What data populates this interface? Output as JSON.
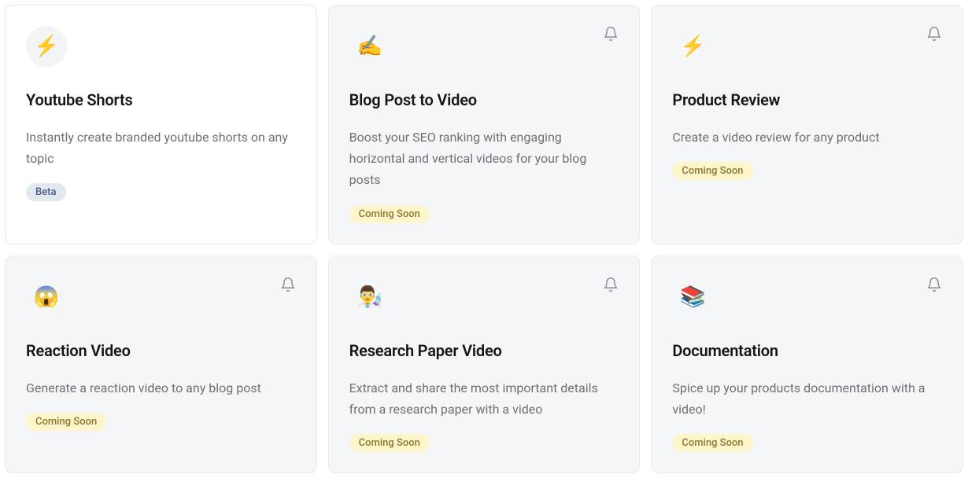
{
  "badges": {
    "beta": "Beta",
    "soon": "Coming Soon"
  },
  "cards": [
    {
      "icon": "⚡",
      "title": "Youtube Shorts",
      "description": "Instantly create branded youtube shorts on any topic",
      "badge": "beta",
      "active": true,
      "bell": false
    },
    {
      "icon": "✍️",
      "title": "Blog Post to Video",
      "description": "Boost your SEO ranking with engaging horizontal and vertical videos for your blog posts",
      "badge": "soon",
      "active": false,
      "bell": true
    },
    {
      "icon": "⚡",
      "title": "Product Review",
      "description": "Create a video review for any product",
      "badge": "soon",
      "active": false,
      "bell": true
    },
    {
      "icon": "😱",
      "title": "Reaction Video",
      "description": "Generate a reaction video to any blog post",
      "badge": "soon",
      "active": false,
      "bell": true
    },
    {
      "icon": "👨‍🔬",
      "title": "Research Paper Video",
      "description": "Extract and share the most important details from a research paper with a video",
      "badge": "soon",
      "active": false,
      "bell": true
    },
    {
      "icon": "📚",
      "title": "Documentation",
      "description": "Spice up your products documentation with a video!",
      "badge": "soon",
      "active": false,
      "bell": true
    }
  ]
}
